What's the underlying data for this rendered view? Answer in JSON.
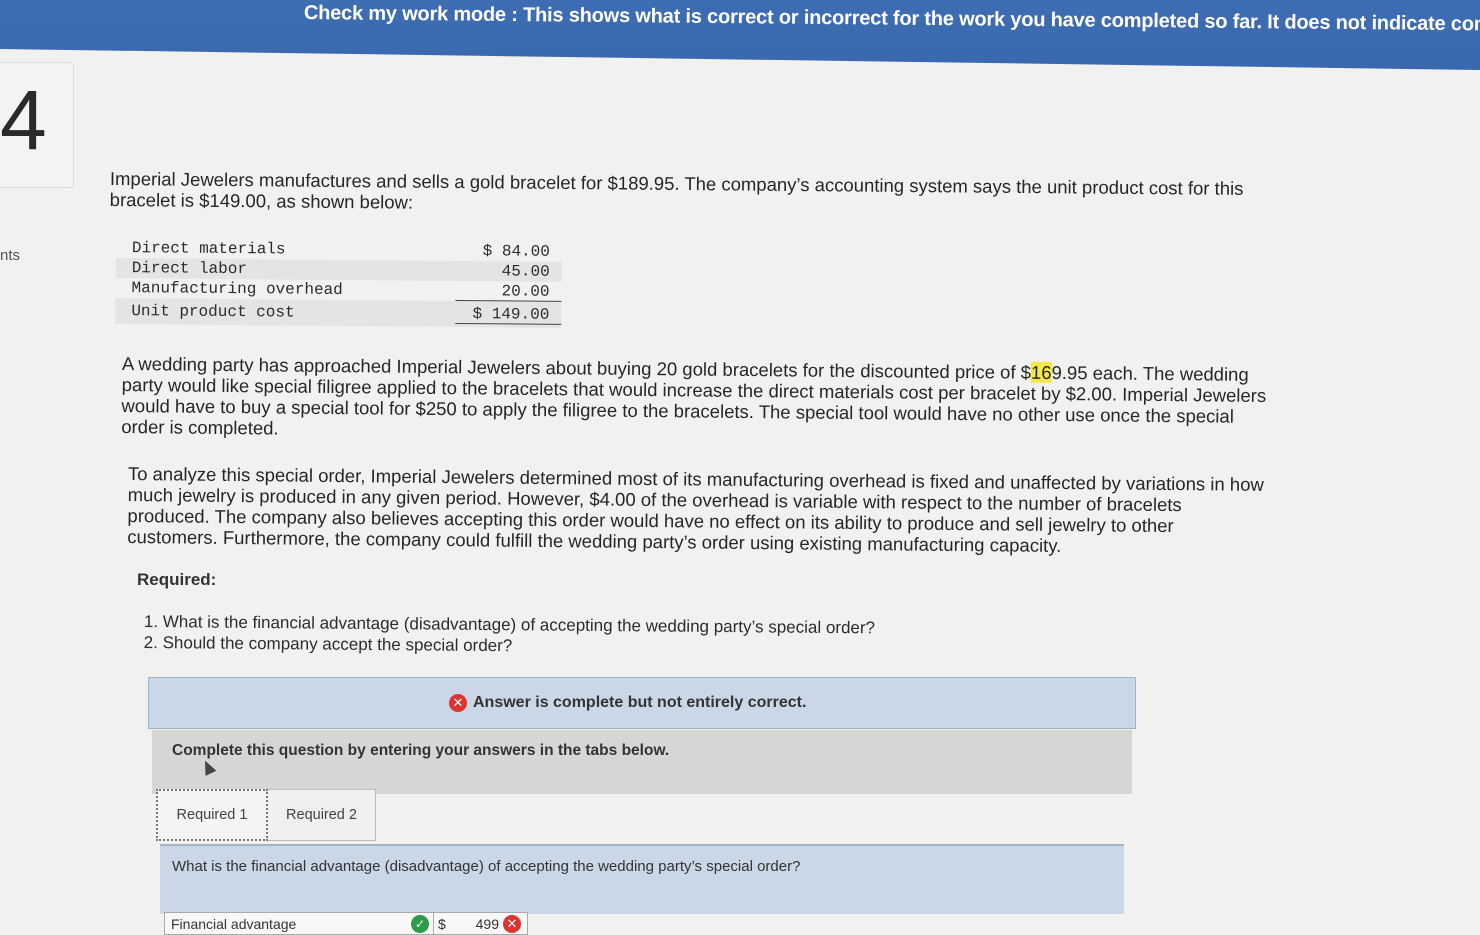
{
  "banner": {
    "text": "Check my work mode : This shows what is correct or incorrect for the work you have completed so far. It does not indicate comp"
  },
  "question": {
    "number": "4",
    "points_label": "nts"
  },
  "problem": {
    "p1": "Imperial Jewelers manufactures and sells a gold bracelet for $189.95. The company’s accounting system says the unit product cost for this bracelet is $149.00, as shown below:",
    "cost_table": [
      {
        "label": "Direct materials",
        "value": "$ 84.00"
      },
      {
        "label": "Direct labor",
        "value": "45.00"
      },
      {
        "label": "Manufacturing overhead",
        "value": "20.00"
      },
      {
        "label": "Unit product cost",
        "value": "$ 149.00"
      }
    ],
    "p2_before": "A wedding party has approached Imperial Jewelers about buying 20 gold bracelets for the discounted price of $",
    "p2_highlight": "16",
    "p2_after": "9.95 each. The wedding party would like special filigree applied to the bracelets that would increase the direct materials cost per bracelet by $2.00. Imperial Jewelers would have to buy a special tool for $250 to apply the filigree to the bracelets. The special tool would have no other use once the special order is completed.",
    "p3": "To analyze this special order, Imperial Jewelers determined most of its manufacturing overhead is fixed and unaffected by variations in how much jewelry is produced in any given period. However, $4.00 of the overhead is variable with respect to the number of bracelets produced. The company also believes accepting this order would have no effect on its ability to produce and sell jewelry to other customers. Furthermore, the company could fulfill the wedding party’s order using existing manufacturing capacity."
  },
  "required": {
    "heading": "Required:",
    "items": [
      "1. What is the financial advantage (disadvantage) of accepting the wedding party’s special order?",
      "2. Should the company accept the special order?"
    ]
  },
  "feedback": {
    "status": "Answer is complete but not entirely correct.",
    "status_color": "#dd3333"
  },
  "instructions": "Complete this question by entering your answers in the tabs below.",
  "tabs": [
    {
      "label": "Required 1",
      "active": true
    },
    {
      "label": "Required 2",
      "active": false
    }
  ],
  "panel": {
    "question": "What is the financial advantage (disadvantage) of accepting the wedding party’s special order?",
    "answer_label": "Financial advantage",
    "label_correct_icon": "check-icon",
    "currency": "$",
    "answer_value": "499",
    "value_incorrect_icon": "x-icon"
  }
}
